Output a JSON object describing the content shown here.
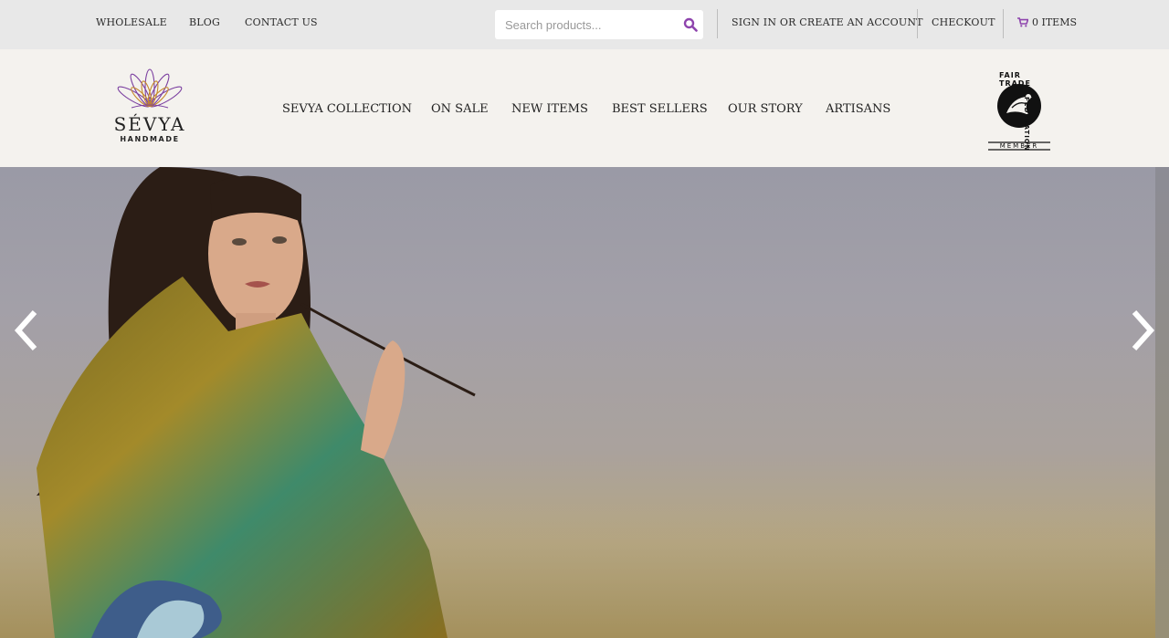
{
  "topbar": {
    "links": [
      "WHOLESALE",
      "BLOG",
      "CONTACT US"
    ],
    "search_placeholder": "Search products...",
    "account_link": "SIGN IN OR CREATE AN ACCOUNT",
    "checkout_link": "CHECKOUT",
    "cart_label": "0 ITEMS",
    "accent_color": "#8e44ad"
  },
  "header": {
    "logo_name": "SÉVYA",
    "logo_sub": "HANDMADE",
    "nav": [
      "SEVYA COLLECTION",
      "ON SALE",
      "NEW ITEMS",
      "BEST SELLERS",
      "OUR STORY",
      "ARTISANS"
    ],
    "badge_text_top": "FAIR TRADE",
    "badge_text_side": "FEDERATION",
    "badge_member": "MEMBER"
  },
  "hero": {
    "prev_icon": "chevron-left-icon",
    "next_icon": "chevron-right-icon"
  }
}
